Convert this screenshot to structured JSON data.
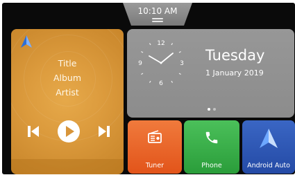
{
  "status": {
    "time": "10:10 AM"
  },
  "media": {
    "title": "Title",
    "album": "Album",
    "artist": "Artist",
    "controls": [
      "previous-track",
      "play",
      "next-track"
    ]
  },
  "date_widget": {
    "clock_numbers": [
      "12",
      "3",
      "6",
      "9"
    ],
    "day": "Tuesday",
    "date": "1 January 2019",
    "page_indicator": {
      "pages": 2,
      "active": 1
    }
  },
  "apps": [
    {
      "label": "Tuner",
      "icon": "radio-icon",
      "color": "#e65a1e"
    },
    {
      "label": "Phone",
      "icon": "phone-icon",
      "color": "#33a842"
    },
    {
      "label": "Android Auto",
      "icon": "android-auto-icon",
      "color": "#2c55b3"
    }
  ],
  "colors": {
    "media_card": "#dc9b3d",
    "date_card": "#929292",
    "background": "#0a0a0a"
  }
}
